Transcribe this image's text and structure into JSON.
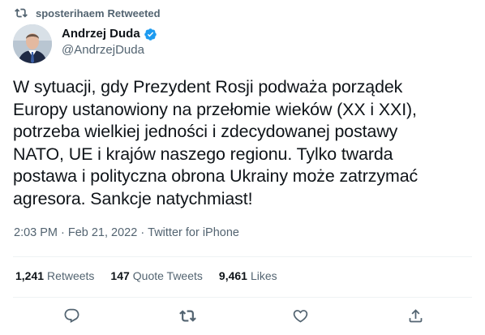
{
  "retweet_context": {
    "user": "sposterihaem",
    "label": "Retweeted",
    "icon": "retweet-icon"
  },
  "author": {
    "display_name": "Andrzej Duda",
    "handle": "@AndrzejDuda",
    "verified_icon": "verified-badge-icon",
    "verified_color": "#1d9bf0"
  },
  "tweet": {
    "lines": [
      "W sytuacji, gdy Prezydent Rosji podważa porządek",
      "Europy ustanowiony na przełomie wieków (XX i XXI),",
      "potrzeba wielkiej jedności i zdecydowanej postawy",
      "NATO, UE i krajów naszego regionu. Tylko twarda",
      "postawa i polityczna obrona Ukrainy może zatrzymać",
      "agresora. Sankcje natychmiast!"
    ]
  },
  "meta": {
    "time": "2:03 PM",
    "separator": "·",
    "date": "Feb 21, 2022",
    "source": "Twitter for iPhone"
  },
  "stats": {
    "retweets_count": "1,241",
    "retweets_label": "Retweets",
    "quotes_count": "147",
    "quotes_label": "Quote Tweets",
    "likes_count": "9,461",
    "likes_label": "Likes"
  },
  "actions": {
    "reply_icon": "reply-icon",
    "retweet_icon": "retweet-icon",
    "like_icon": "like-icon",
    "share_icon": "share-icon"
  },
  "colors": {
    "text": "#0f1419",
    "secondary": "#536471",
    "divider": "#eff3f4",
    "accent": "#1d9bf0"
  }
}
